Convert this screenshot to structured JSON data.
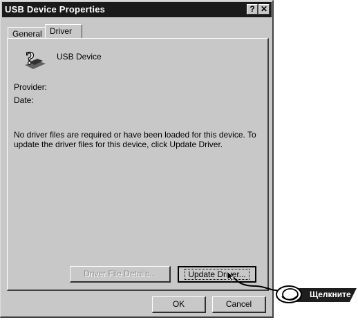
{
  "window": {
    "title": "USB Device Properties",
    "help_label": "?",
    "close_label": "✕"
  },
  "tabs": [
    {
      "label": "General",
      "active": false
    },
    {
      "label": "Driver",
      "active": true
    }
  ],
  "device": {
    "name": "USB Device",
    "icon": "unknown-device-icon"
  },
  "fields": {
    "provider_label": "Provider:",
    "date_label": "Date:"
  },
  "message": "No driver files are required or have been loaded for this device.  To update the driver files for this device, click Update Driver.",
  "buttons": {
    "driver_file_details": "Driver File Details...",
    "update_driver": "Update Driver...",
    "ok": "OK",
    "cancel": "Cancel"
  },
  "callout": {
    "text": "Щелкните"
  },
  "colors": {
    "titlebar": "#1a1a1a",
    "face": "#c8c8c8"
  }
}
